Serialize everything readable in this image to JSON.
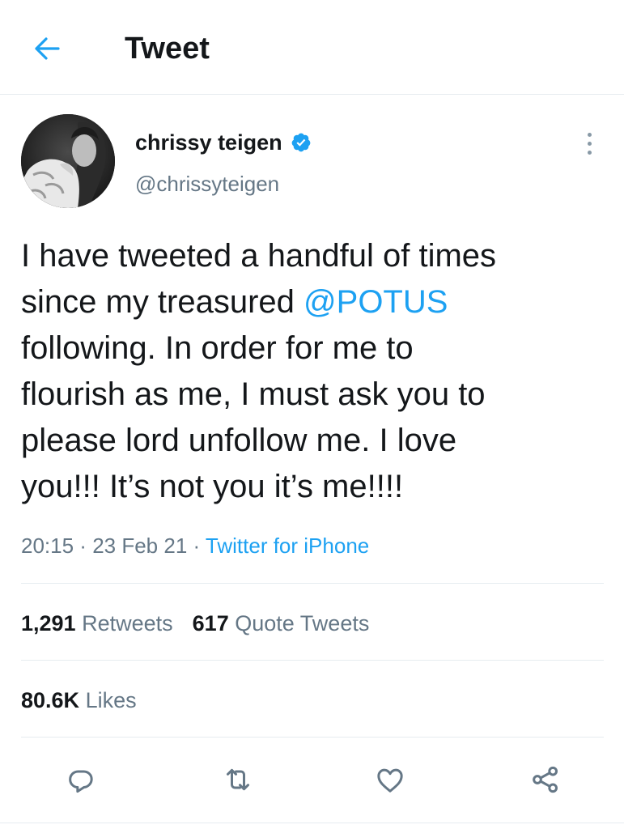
{
  "header": {
    "title": "Tweet",
    "back_icon": "arrow-left-icon"
  },
  "author": {
    "display_name": "chrissy teigen",
    "handle": "@chrissyteigen",
    "verified_icon": "verified-badge-icon"
  },
  "tweet": {
    "text_before": "I have tweeted a handful of times\nsince my treasured ",
    "mention": "@POTUS",
    "text_after": "\nfollowing. In order for me to\nflourish as me, I must ask you to\nplease lord unfollow me. I love\nyou!!! It’s not you it’s me!!!!",
    "time": "20:15",
    "separator": " · ",
    "date": "23 Feb 21",
    "source": "Twitter for iPhone"
  },
  "stats": {
    "retweets_count": "1,291",
    "retweets_label": "Retweets",
    "quotes_count": "617",
    "quotes_label": "Quote Tweets",
    "likes_count": "80.6K",
    "likes_label": "Likes"
  },
  "actions": {
    "reply_icon": "reply-icon",
    "retweet_icon": "retweet-icon",
    "like_icon": "heart-icon",
    "share_icon": "share-icon"
  },
  "colors": {
    "accent": "#1da1f2",
    "secondary_text": "#657786",
    "primary_text": "#14171a",
    "divider": "#e6ecf0"
  }
}
